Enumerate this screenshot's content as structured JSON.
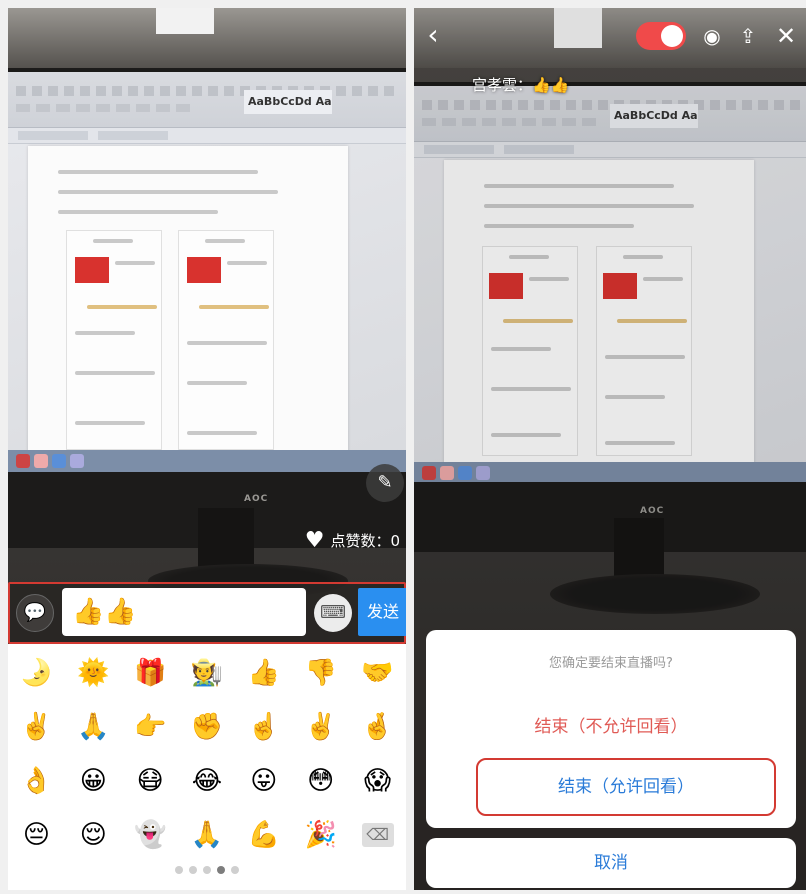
{
  "left_panel": {
    "likes_label": "点赞数：0",
    "message_input_value": "👍👍",
    "send_label": "发送",
    "emojis": [
      "🌛",
      "🌞",
      "🎁",
      "🧑‍🌾",
      "👍",
      "👎",
      "🤝",
      "✌️",
      "🙏",
      "👉",
      "✊",
      "☝️",
      "✌️",
      "🤞",
      "👌",
      "😀",
      "😷",
      "😂",
      "😛",
      "😳",
      "😱",
      "😔",
      "😌",
      "👻",
      "🙏",
      "💪",
      "🎉"
    ],
    "delete_key": "⌫",
    "pager_active_index": 3,
    "pager_count": 5,
    "screen": {
      "ribbon_styles": "AaBbCcDd AaBb AaBbCc"
    },
    "monitor_brand": "AOC"
  },
  "right_panel": {
    "comment_text": "宫孝雲：👍👍",
    "dialog": {
      "prompt": "您确定要结束直播吗?",
      "option_no_replay": "结束（不允许回看）",
      "option_allow_replay": "结束（允许回看）",
      "cancel": "取消"
    },
    "monitor_brand": "AOC"
  },
  "colors": {
    "send": "#2a8ff0",
    "highlight_border": "#d33a32",
    "dialog_warn": "#e05a55",
    "dialog_action": "#2a7bd8",
    "toggle": "#f04a4a"
  },
  "icons": {
    "pen": "pen-icon",
    "heart": "heart-icon",
    "chat": "chat-bubble-icon",
    "keyboard": "keyboard-icon",
    "camera": "camera-icon",
    "share": "share-icon",
    "close": "close-icon",
    "back": "back-icon"
  }
}
